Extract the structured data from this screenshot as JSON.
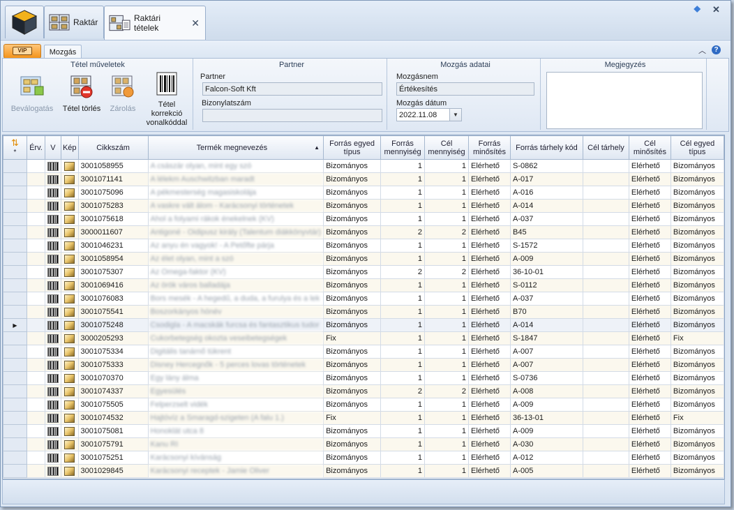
{
  "tabs": {
    "raktar": "Raktár",
    "tetelek": "Raktári tételek",
    "close": "✕"
  },
  "window": {
    "pin": "⯁",
    "close": "✕"
  },
  "ribbon": {
    "vip_badge": "VIP",
    "tab_mozgas": "Mozgás",
    "groups": {
      "tetel": "Tétel műveletek",
      "partner": "Partner",
      "mozgas": "Mozgás adatai",
      "megjegyzes": "Megjegyzés"
    },
    "buttons": {
      "bevalogatas": "Beválogatás",
      "torles": "Tétel törlés",
      "zarolas": "Zárolás",
      "korrekcio": "Tétel korrekció vonalkóddal"
    },
    "partner_label": "Partner",
    "partner_value": "Falcon-Soft Kft",
    "bizonylat_label": "Bizonylatszám",
    "bizonylat_value": "",
    "mozgasnem_label": "Mozgásnem",
    "mozgasnem_value": "Értékesítés",
    "datum_label": "Mozgás dátum",
    "datum_value": "2022.11.08"
  },
  "grid": {
    "columns": [
      "Érv.",
      "V",
      "Kép",
      "Cikkszám",
      "Termék megnevezés",
      "Forrás egyed típus",
      "Forrás mennyiség",
      "Cél mennyiség",
      "Forrás minősítés",
      "Forrás tárhely kód",
      "Cél tárhely",
      "Cél minősítés",
      "Cél egyed típus"
    ],
    "rows": [
      {
        "cikk": "3001058955",
        "nev": "A császár olyan, mint egy szó",
        "ft": "Bizományos",
        "fm": "1",
        "cm": "1",
        "fmin": "Elérhető",
        "fth": "S-0862",
        "cth": "",
        "cmin": "Elérhető",
        "cet": "Bizományos"
      },
      {
        "cikk": "3001071141",
        "nev": "A lélekm Auschwitzban maradt",
        "ft": "Bizományos",
        "fm": "1",
        "cm": "1",
        "fmin": "Elérhető",
        "fth": "A-017",
        "cth": "",
        "cmin": "Elérhető",
        "cet": "Bizományos"
      },
      {
        "cikk": "3001075096",
        "nev": "A pékmesterség magasiskolája",
        "ft": "Bizományos",
        "fm": "1",
        "cm": "1",
        "fmin": "Elérhető",
        "fth": "A-016",
        "cth": "",
        "cmin": "Elérhető",
        "cet": "Bizományos"
      },
      {
        "cikk": "3001075283",
        "nev": "A vaskre vált álom - Karácsonyi történetek",
        "ft": "Bizományos",
        "fm": "1",
        "cm": "1",
        "fmin": "Elérhető",
        "fth": "A-014",
        "cth": "",
        "cmin": "Elérhető",
        "cet": "Bizományos"
      },
      {
        "cikk": "3001075618",
        "nev": "Ahol a folyami rákok énekelnek (KV)",
        "ft": "Bizományos",
        "fm": "1",
        "cm": "1",
        "fmin": "Elérhető",
        "fth": "A-037",
        "cth": "",
        "cmin": "Elérhető",
        "cet": "Bizományos"
      },
      {
        "cikk": "3000011607",
        "nev": "Antigoné - Oidipusz király (Talentum diákkönyvtár)",
        "ft": "Bizományos",
        "fm": "2",
        "cm": "2",
        "fmin": "Elérhető",
        "fth": "B45",
        "cth": "",
        "cmin": "Elérhető",
        "cet": "Bizományos"
      },
      {
        "cikk": "3001046231",
        "nev": "Az anyu én vagyok! - A Petőfte párja",
        "ft": "Bizományos",
        "fm": "1",
        "cm": "1",
        "fmin": "Elérhető",
        "fth": "S-1572",
        "cth": "",
        "cmin": "Elérhető",
        "cet": "Bizományos"
      },
      {
        "cikk": "3001058954",
        "nev": "Az élet olyan, mint a szó",
        "ft": "Bizományos",
        "fm": "1",
        "cm": "1",
        "fmin": "Elérhető",
        "fth": "A-009",
        "cth": "",
        "cmin": "Elérhető",
        "cet": "Bizományos"
      },
      {
        "cikk": "3001075307",
        "nev": "Az Omega-faktor (KV)",
        "ft": "Bizományos",
        "fm": "2",
        "cm": "2",
        "fmin": "Elérhető",
        "fth": "36-10-01",
        "cth": "",
        "cmin": "Elérhető",
        "cet": "Bizományos"
      },
      {
        "cikk": "3001069416",
        "nev": "Az örök város balladája",
        "ft": "Bizományos",
        "fm": "1",
        "cm": "1",
        "fmin": "Elérhető",
        "fth": "S-0112",
        "cth": "",
        "cmin": "Elérhető",
        "cet": "Bizományos"
      },
      {
        "cikk": "3001076083",
        "nev": "Bors mesék - A hegedű, a duda, a furulya és a lek",
        "ft": "Bizományos",
        "fm": "1",
        "cm": "1",
        "fmin": "Elérhető",
        "fth": "A-037",
        "cth": "",
        "cmin": "Elérhető",
        "cet": "Bizományos"
      },
      {
        "cikk": "3001075541",
        "nev": "Boszorkányos hónév",
        "ft": "Bizományos",
        "fm": "1",
        "cm": "1",
        "fmin": "Elérhető",
        "fth": "B70",
        "cth": "",
        "cmin": "Elérhető",
        "cet": "Bizományos"
      },
      {
        "cikk": "3001075248",
        "nev": "Csodigla - A macskák furcsa és fantasztikus tudor",
        "ft": "Bizományos",
        "fm": "1",
        "cm": "1",
        "fmin": "Elérhető",
        "fth": "A-014",
        "cth": "",
        "cmin": "Elérhető",
        "cet": "Bizományos"
      },
      {
        "cikk": "3000205293",
        "nev": "Cukorbetegség okozta veseibetegségek",
        "ft": "Fix",
        "fm": "1",
        "cm": "1",
        "fmin": "Elérhető",
        "fth": "S-1847",
        "cth": "",
        "cmin": "Elérhető",
        "cet": "Fix"
      },
      {
        "cikk": "3001075334",
        "nev": "Digitális tanárnő tükrent",
        "ft": "Bizományos",
        "fm": "1",
        "cm": "1",
        "fmin": "Elérhető",
        "fth": "A-007",
        "cth": "",
        "cmin": "Elérhető",
        "cet": "Bizományos"
      },
      {
        "cikk": "3001075333",
        "nev": "Disney Hercegnők - 5 perces lovas történetek",
        "ft": "Bizományos",
        "fm": "1",
        "cm": "1",
        "fmin": "Elérhető",
        "fth": "A-007",
        "cth": "",
        "cmin": "Elérhető",
        "cet": "Bizományos"
      },
      {
        "cikk": "3001070370",
        "nev": "Egy lány álma",
        "ft": "Bizományos",
        "fm": "1",
        "cm": "1",
        "fmin": "Elérhető",
        "fth": "S-0736",
        "cth": "",
        "cmin": "Elérhető",
        "cet": "Bizományos"
      },
      {
        "cikk": "3001074337",
        "nev": "Egyesülés",
        "ft": "Bizományos",
        "fm": "2",
        "cm": "2",
        "fmin": "Elérhető",
        "fth": "A-008",
        "cth": "",
        "cmin": "Elérhető",
        "cet": "Bizományos"
      },
      {
        "cikk": "3001075505",
        "nev": "Felperzselt vidék",
        "ft": "Bizományos",
        "fm": "1",
        "cm": "1",
        "fmin": "Elérhető",
        "fth": "A-009",
        "cth": "",
        "cmin": "Elérhető",
        "cet": "Bizományos"
      },
      {
        "cikk": "3001074532",
        "nev": "Hajtóvíz a Smaragd-szigeten (A falu 1.)",
        "ft": "Fix",
        "fm": "1",
        "cm": "1",
        "fmin": "Elérhető",
        "fth": "36-13-01",
        "cth": "",
        "cmin": "Elérhető",
        "cet": "Fix"
      },
      {
        "cikk": "3001075081",
        "nev": "Honoklát utca 8",
        "ft": "Bizományos",
        "fm": "1",
        "cm": "1",
        "fmin": "Elérhető",
        "fth": "A-009",
        "cth": "",
        "cmin": "Elérhető",
        "cet": "Bizományos"
      },
      {
        "cikk": "3001075791",
        "nev": "Kanu RI",
        "ft": "Bizományos",
        "fm": "1",
        "cm": "1",
        "fmin": "Elérhető",
        "fth": "A-030",
        "cth": "",
        "cmin": "Elérhető",
        "cet": "Bizományos"
      },
      {
        "cikk": "3001075251",
        "nev": "Karácsonyi kívánság",
        "ft": "Bizományos",
        "fm": "1",
        "cm": "1",
        "fmin": "Elérhető",
        "fth": "A-012",
        "cth": "",
        "cmin": "Elérhető",
        "cet": "Bizományos"
      },
      {
        "cikk": "3001029845",
        "nev": "Karácsonyi receptek - Jamie Oliver",
        "ft": "Bizományos",
        "fm": "1",
        "cm": "1",
        "fmin": "Elérhető",
        "fth": "A-005",
        "cth": "",
        "cmin": "Elérhető",
        "cet": "Bizományos"
      }
    ],
    "selected_index": 12
  }
}
